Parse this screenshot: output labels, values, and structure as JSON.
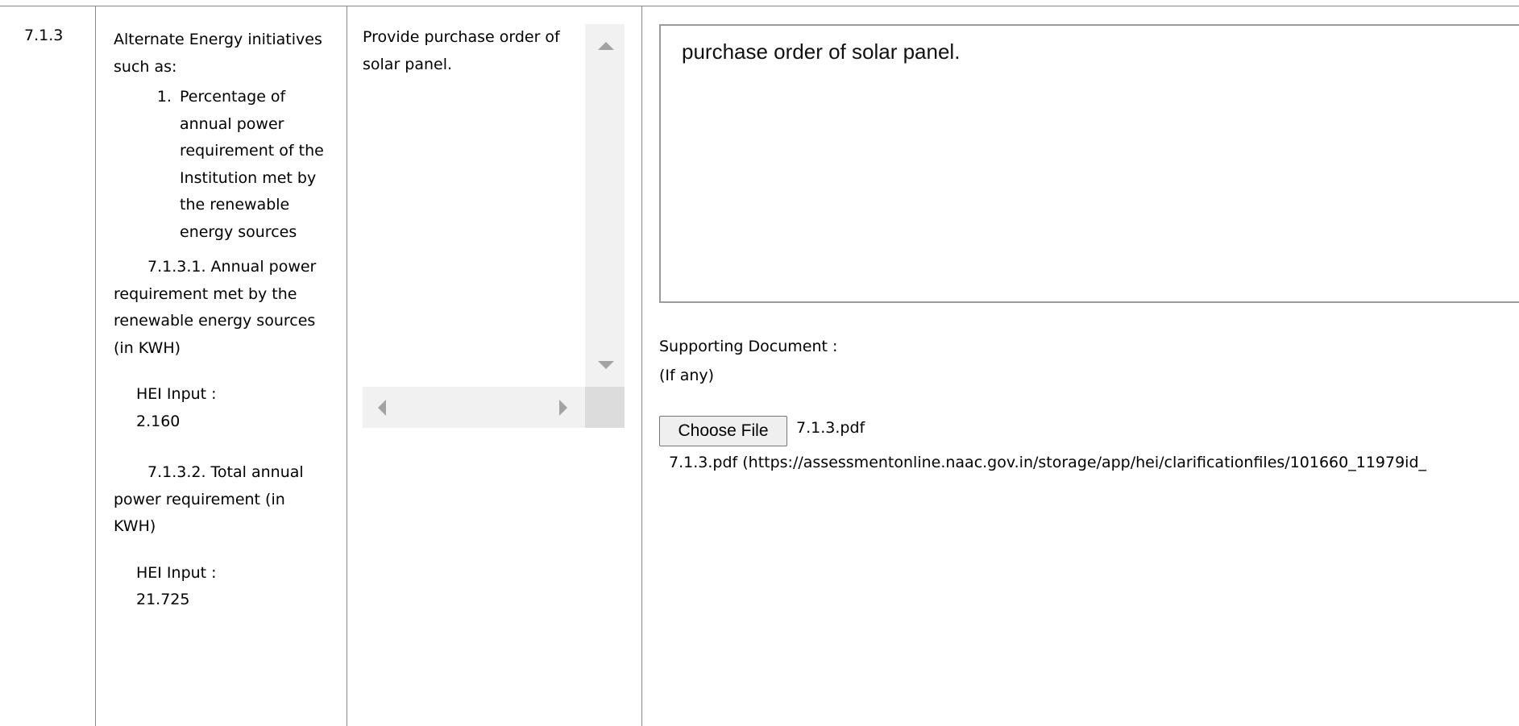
{
  "row": {
    "number": "7.1.3",
    "criteria": {
      "intro": "Alternate Energy initiatives such as:",
      "list": [
        "Percentage of annual power requirement of the Institution met by the renewable energy sources"
      ],
      "metric1": "7.1.3.1. Annual power requirement met by the renewable energy sources (in KWH)",
      "hei_label": "HEI Input :",
      "hei_value1": "2.160",
      "metric2": "7.1.3.2. Total annual power requirement (in KWH)",
      "hei_value2": "21.725"
    },
    "question": "Provide purchase order of solar panel.",
    "response": "purchase order of solar panel.",
    "supporting": {
      "label_line1": "Supporting Document :",
      "label_line2": "(If any)",
      "button_label": "Choose File",
      "chosen_file": "7.1.3.pdf",
      "link_text": "7.1.3.pdf (https://assessmentonline.naac.gov.in/storage/app/hei/clarificationfiles/101660_11979id_"
    }
  },
  "icons": [
    "scroll-up-arrow-icon",
    "scroll-down-arrow-icon",
    "scroll-left-arrow-icon",
    "scroll-right-arrow-icon"
  ],
  "colors": {
    "border": "#8a8a8a",
    "scrollbar": "#f1f1f1",
    "button": "#efefef"
  }
}
